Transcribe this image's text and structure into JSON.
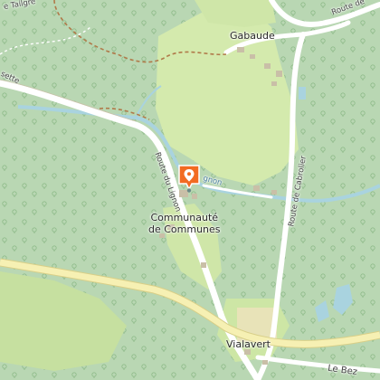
{
  "map": {
    "colors": {
      "forest": "#b9d7b3",
      "meadow": "#d4eaad",
      "road_major": "#f6f0b3",
      "road_white": "#ffffff",
      "water": "#a9d3df",
      "marker": "#f26b22"
    },
    "labels": {
      "gabaude": "Gabaude",
      "communaute_line1": "Communauté",
      "communaute_line2": "de Communes",
      "vialavert": "Vialavert",
      "le_bez": "Le Bez"
    },
    "road_labels": {
      "route_du_lignon": "Route du Lignon",
      "route_de_cabrolier": "Route de Cabrolier",
      "route_de_top": "Route de",
      "lignon_water": "gnon",
      "top_left_fragment": "e Tailgre",
      "left_fragment": "sette"
    },
    "marker": {
      "icon": "location-pin-icon"
    }
  }
}
